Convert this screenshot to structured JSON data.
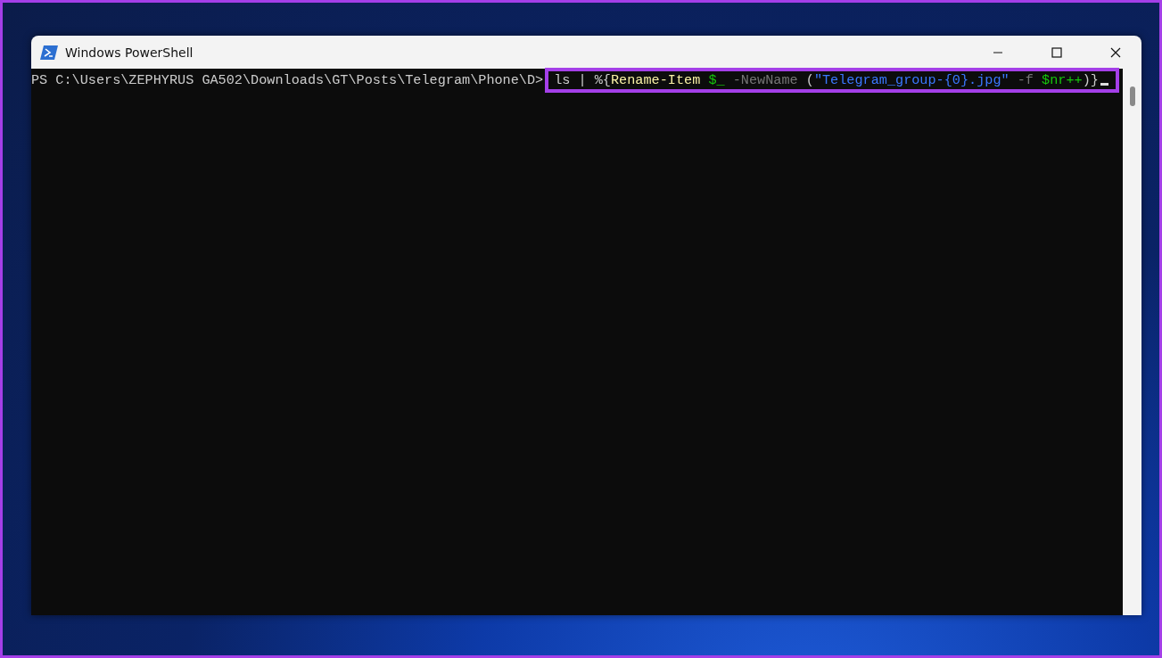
{
  "window": {
    "title": "Windows PowerShell"
  },
  "terminal": {
    "prompt": "PS C:\\Users\\ZEPHYRUS GA502\\Downloads\\GT\\Posts\\Telegram\\Phone\\D>",
    "highlighted": true,
    "cursor": true,
    "command": [
      {
        "text": "ls | %{",
        "kind": "plain"
      },
      {
        "text": "Rename-Item ",
        "kind": "cmdlet"
      },
      {
        "text": "$_ ",
        "kind": "variable"
      },
      {
        "text": "-NewName ",
        "kind": "parameter"
      },
      {
        "text": "(",
        "kind": "plain"
      },
      {
        "text": "\"Telegram_group-{0}.jpg\" ",
        "kind": "string"
      },
      {
        "text": "-f ",
        "kind": "parameter"
      },
      {
        "text": "$nr++",
        "kind": "variable"
      },
      {
        "text": ")}",
        "kind": "plain"
      }
    ]
  }
}
